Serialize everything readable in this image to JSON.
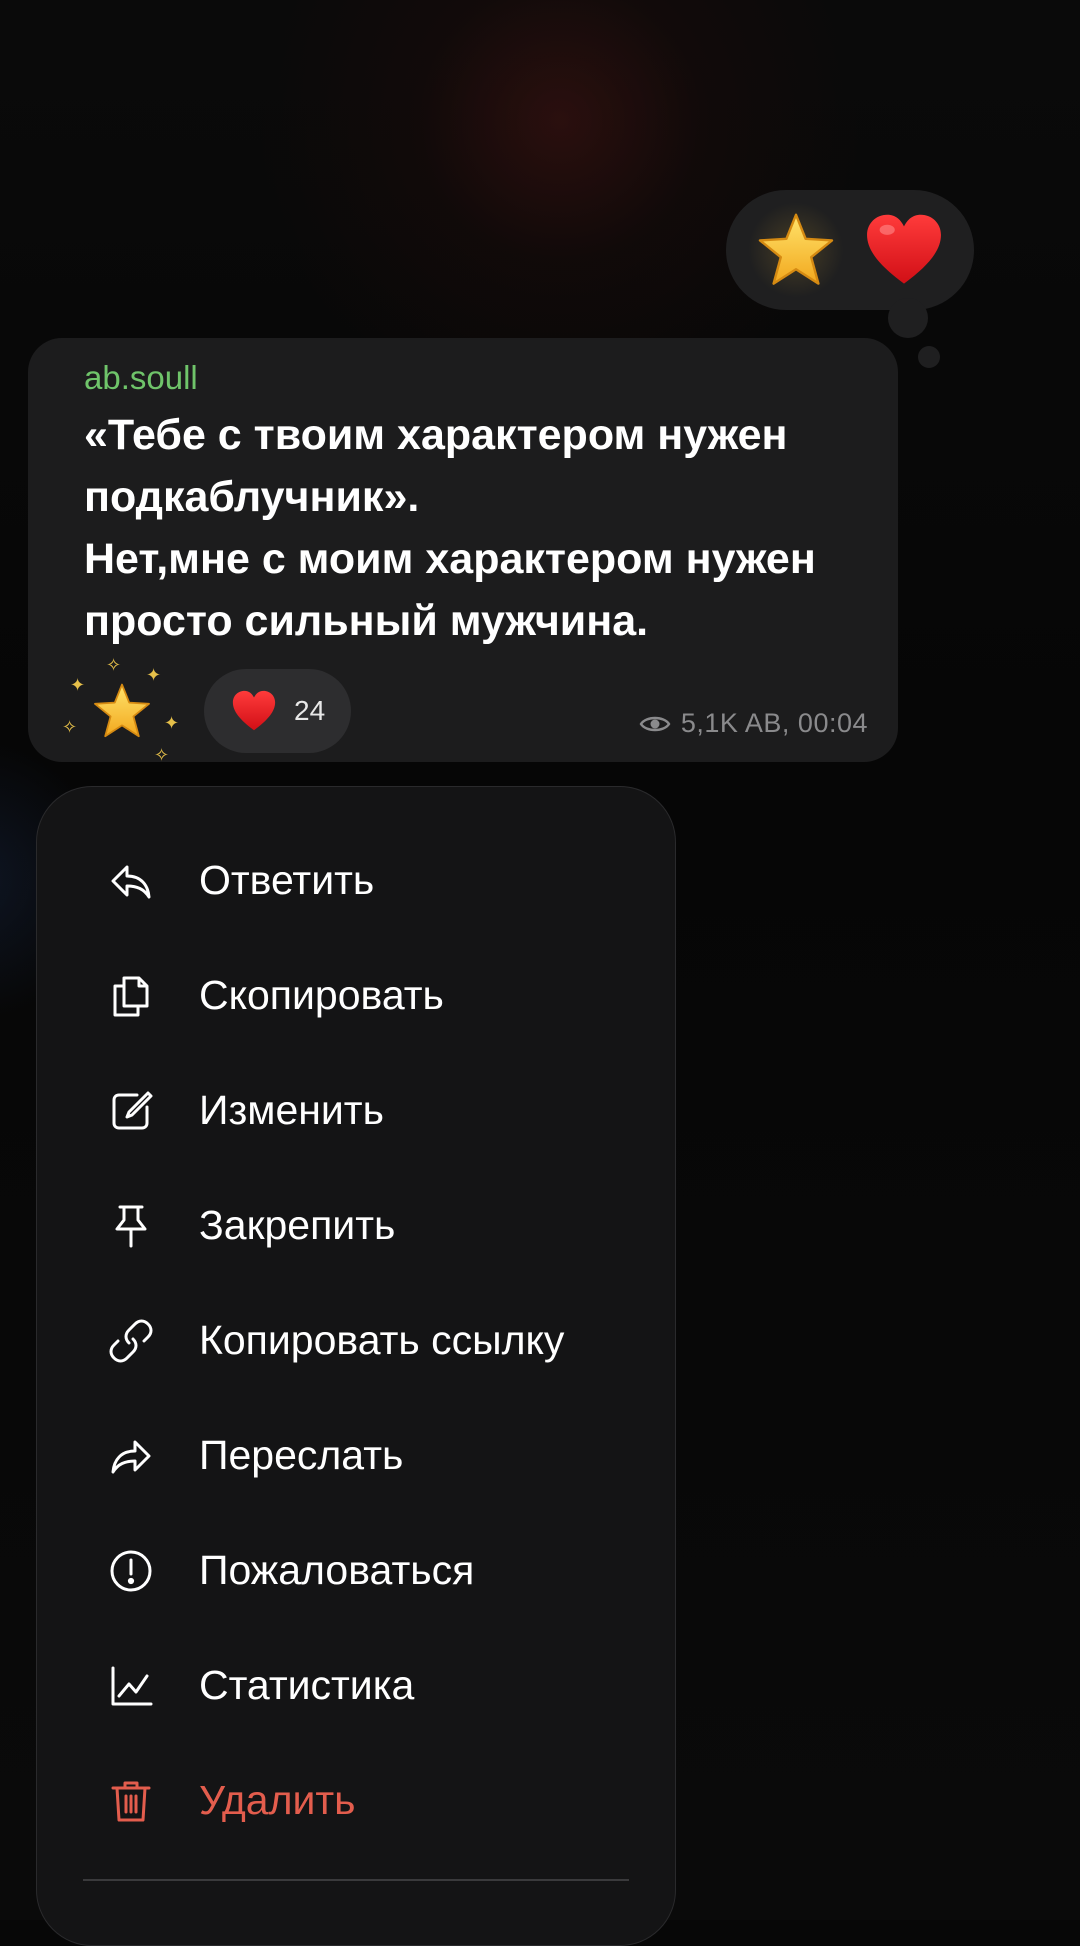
{
  "reaction_picker": {
    "items": [
      {
        "name": "star-emoji"
      },
      {
        "name": "heart-emoji"
      }
    ]
  },
  "message": {
    "author": "ab.soull",
    "lines": [
      "«Тебе с твоим характером нужен подкаблучник».",
      "Нет,мне с моим характером нужен просто сильный мужчина."
    ],
    "reactions": [
      {
        "icon": "star-icon"
      },
      {
        "icon": "heart-icon",
        "count": "24"
      }
    ],
    "meta": {
      "views_icon": "eye-icon",
      "info": "5,1K AB, 00:04"
    }
  },
  "menu": {
    "items": [
      {
        "label": "Ответить",
        "icon": "reply-icon"
      },
      {
        "label": "Скопировать",
        "icon": "copy-icon"
      },
      {
        "label": "Изменить",
        "icon": "edit-icon"
      },
      {
        "label": "Закрепить",
        "icon": "pin-icon"
      },
      {
        "label": "Копировать ссылку",
        "icon": "link-icon"
      },
      {
        "label": "Переслать",
        "icon": "forward-icon"
      },
      {
        "label": "Пожаловаться",
        "icon": "report-icon"
      },
      {
        "label": "Статистика",
        "icon": "statistics-icon"
      },
      {
        "label": "Удалить",
        "icon": "trash-icon"
      }
    ]
  },
  "colors": {
    "author": "#6fc46a",
    "danger": "#e35d4d",
    "bubble": "#1c1c1d",
    "menu": "#141415"
  }
}
